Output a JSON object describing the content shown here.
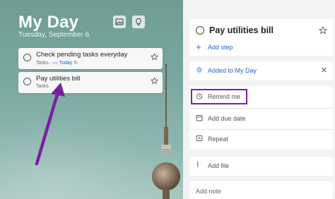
{
  "left": {
    "title": "My Day",
    "date": "Tuesday, September 6",
    "tasks": [
      {
        "title": "Check pending tasks everyday",
        "list": "Tasks",
        "due": "Today"
      },
      {
        "title": "Pay utilities bill",
        "list": "Tasks"
      }
    ],
    "icons": {
      "background": "image-icon",
      "suggestions": "lightbulb-icon"
    }
  },
  "right": {
    "task_title": "Pay utilities bill",
    "add_step": "Add step",
    "added_to_my_day": "Added to My Day",
    "remind_me": "Remind me",
    "add_due_date": "Add due date",
    "repeat": "Repeat",
    "add_file": "Add file",
    "add_note": "Add note"
  },
  "colors": {
    "accent": "#2564cf",
    "highlight": "#7b1fa2",
    "bg": "#f3f3f3"
  }
}
